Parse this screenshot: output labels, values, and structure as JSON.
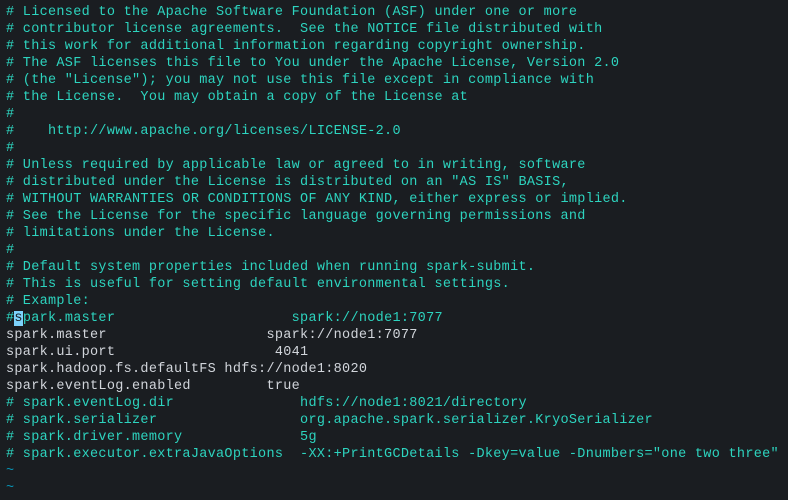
{
  "license": {
    "l1": "# Licensed to the Apache Software Foundation (ASF) under one or more",
    "l2": "# contributor license agreements.  See the NOTICE file distributed with",
    "l3": "# this work for additional information regarding copyright ownership.",
    "l4": "# The ASF licenses this file to You under the Apache License, Version 2.0",
    "l5": "# (the \"License\"); you may not use this file except in compliance with",
    "l6": "# the License.  You may obtain a copy of the License at",
    "l7": "#",
    "l8": "#    http://www.apache.org/licenses/LICENSE-2.0",
    "l9": "#",
    "l10": "# Unless required by applicable law or agreed to in writing, software",
    "l11": "# distributed under the License is distributed on an \"AS IS\" BASIS,",
    "l12": "# WITHOUT WARRANTIES OR CONDITIONS OF ANY KIND, either express or implied.",
    "l13": "# See the License for the specific language governing permissions and",
    "l14": "# limitations under the License.",
    "l15": "#"
  },
  "blank": "",
  "description": {
    "l1": "# Default system properties included when running spark-submit.",
    "l2": "# This is useful for setting default environmental settings."
  },
  "example": {
    "header": "# Example:",
    "cursor_hash": "#",
    "cursor_char": "s",
    "cursor_rest": "park.master                     spark://node1:7077"
  },
  "config": {
    "l1": "spark.master                   spark://node1:7077",
    "l2": "spark.ui.port                   4041",
    "l3": "spark.hadoop.fs.defaultFS hdfs://node1:8020",
    "l4": "spark.eventLog.enabled         true"
  },
  "commented_config": {
    "l1": "# spark.eventLog.dir               hdfs://node1:8021/directory",
    "l2": "# spark.serializer                 org.apache.spark.serializer.KryoSerializer",
    "l3": "# spark.driver.memory              5g",
    "l4": "# spark.executor.extraJavaOptions  -XX:+PrintGCDetails -Dkey=value -Dnumbers=\"one two three\""
  },
  "tilde": "~"
}
